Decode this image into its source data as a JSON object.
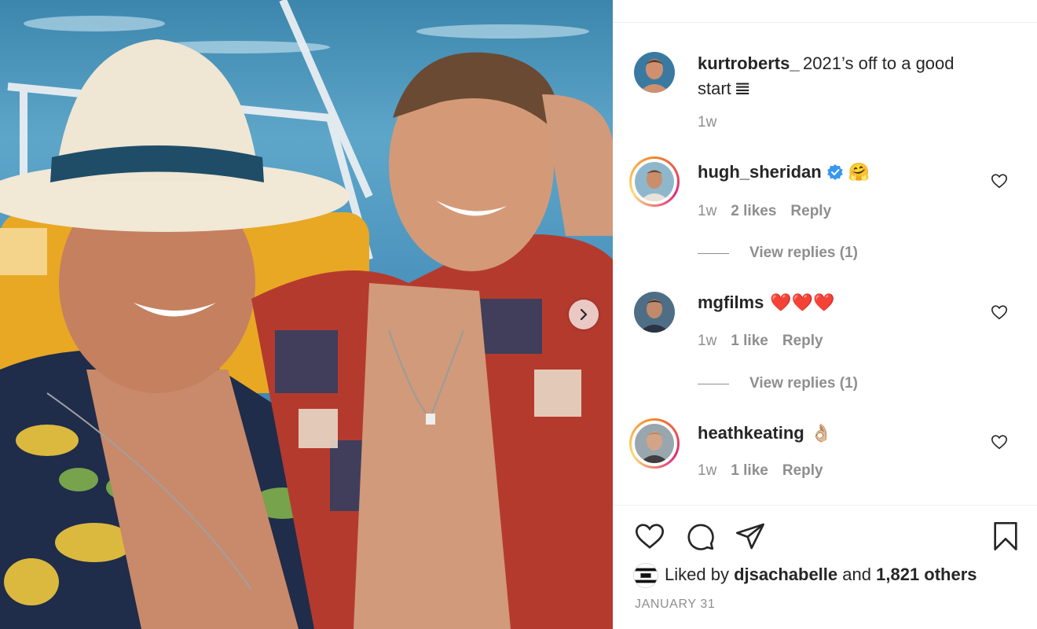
{
  "post": {
    "author": "kurtroberts_",
    "caption_part1": "2021’s off to a good",
    "caption_part2": "start",
    "caption_emoji": "𝌆",
    "time": "1w",
    "photo_next_icon": "chevron-right-icon"
  },
  "comments": [
    {
      "username": "hugh_sheridan",
      "verified": true,
      "text": "🤗",
      "time": "1w",
      "likes": "2 likes",
      "reply_label": "Reply",
      "view_replies": "View replies (1)",
      "story_ring": true
    },
    {
      "username": "mgfilms",
      "verified": false,
      "text": "❤️❤️❤️",
      "time": "1w",
      "likes": "1 like",
      "reply_label": "Reply",
      "view_replies": "View replies (1)",
      "story_ring": false
    },
    {
      "username": "heathkeating",
      "verified": false,
      "text": "👌🏼",
      "time": "1w",
      "likes": "1 like",
      "reply_label": "Reply",
      "story_ring": true
    }
  ],
  "actions": {
    "like_icon": "heart-icon",
    "comment_icon": "comment-bubble-icon",
    "share_icon": "paper-plane-icon",
    "save_icon": "bookmark-icon"
  },
  "likes": {
    "prefix": "Liked by",
    "user": "djsachabelle",
    "and": "and",
    "others": "1,821 others"
  },
  "date": "JANUARY 31",
  "colors": {
    "text": "#262626",
    "secondary": "#8e8e8e",
    "verified": "#3897f0",
    "divider": "#efefef"
  }
}
